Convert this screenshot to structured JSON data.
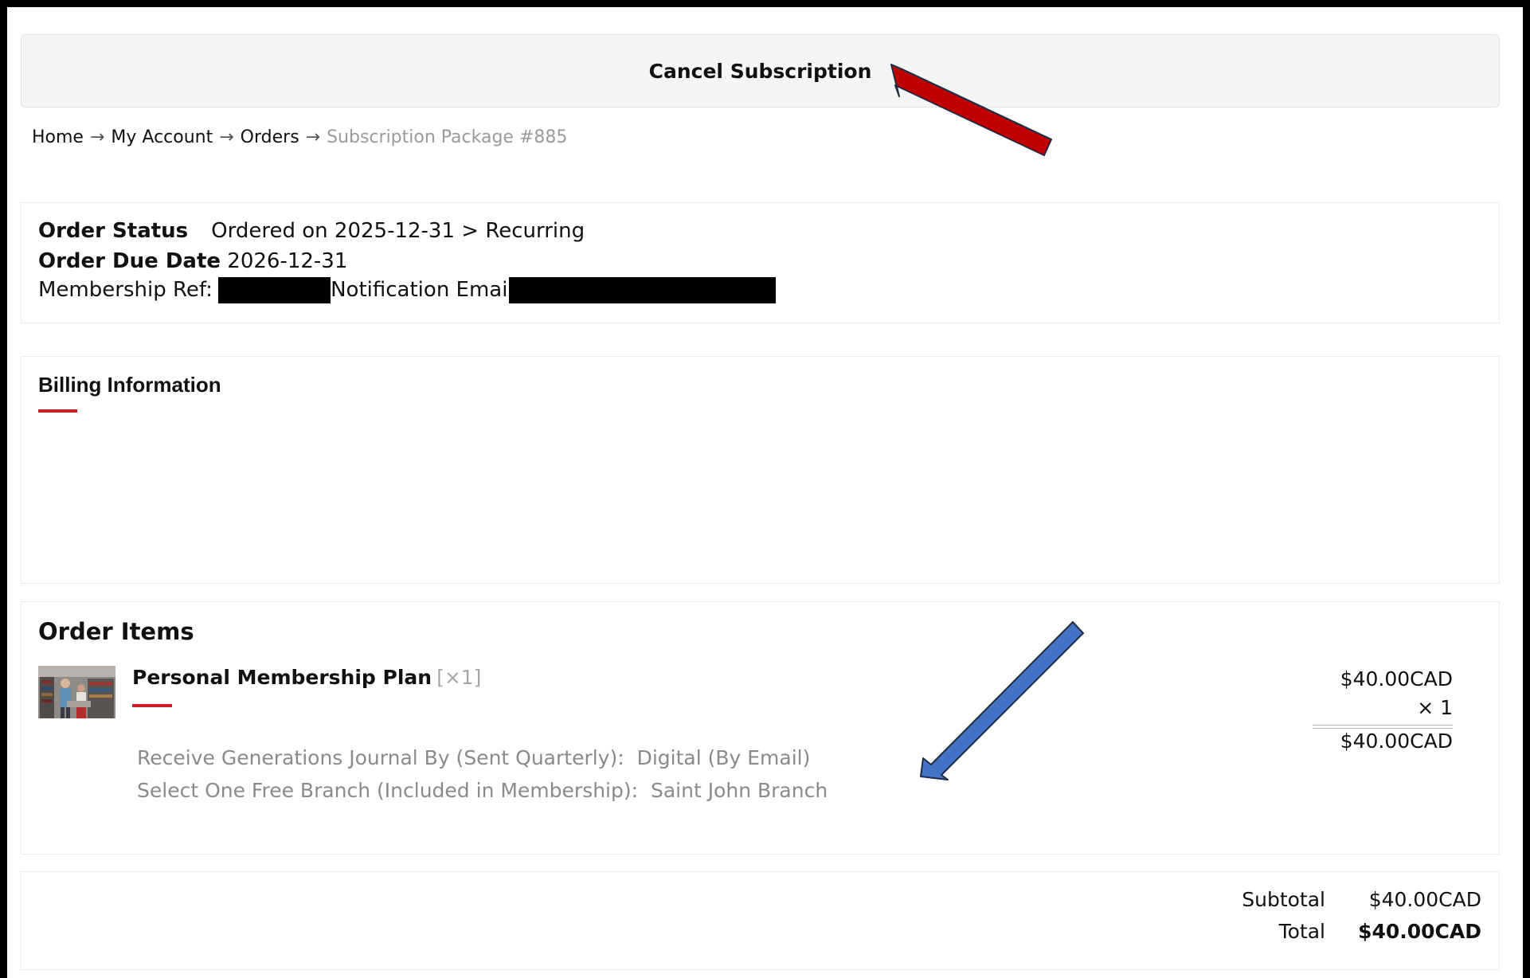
{
  "cancel_button": {
    "label": "Cancel Subscription"
  },
  "breadcrumb": {
    "items": [
      "Home",
      "My Account",
      "Orders"
    ],
    "separator": "→",
    "current": "Subscription Package #885"
  },
  "order_status": {
    "status_label": "Order Status",
    "status_value": "Ordered on 2025-12-31 > Recurring",
    "due_label": "Order Due Date",
    "due_value": "2026-12-31",
    "membership_ref_label": "Membership Ref:",
    "notification_email_label": "Notification Email:"
  },
  "billing": {
    "title": "Billing Information"
  },
  "order_items": {
    "title": "Order Items",
    "items": [
      {
        "name": "Personal Membership Plan",
        "qty_tag": "[×1]",
        "unit_price": "$40.00CAD",
        "multiplier": "× 1",
        "line_total": "$40.00CAD",
        "meta": [
          {
            "label": "Receive Generations Journal By (Sent Quarterly):",
            "value": "Digital (By Email)"
          },
          {
            "label": "Select One Free Branch (Included in Membership):",
            "value": "Saint John Branch"
          }
        ]
      }
    ]
  },
  "totals": {
    "subtotal_label": "Subtotal",
    "subtotal_value": "$40.00CAD",
    "total_label": "Total",
    "total_value": "$40.00CAD"
  },
  "colors": {
    "accent_red": "#c8202b",
    "annotation_red_arrow": "#c00000",
    "annotation_blue_arrow": "#4472c4"
  }
}
